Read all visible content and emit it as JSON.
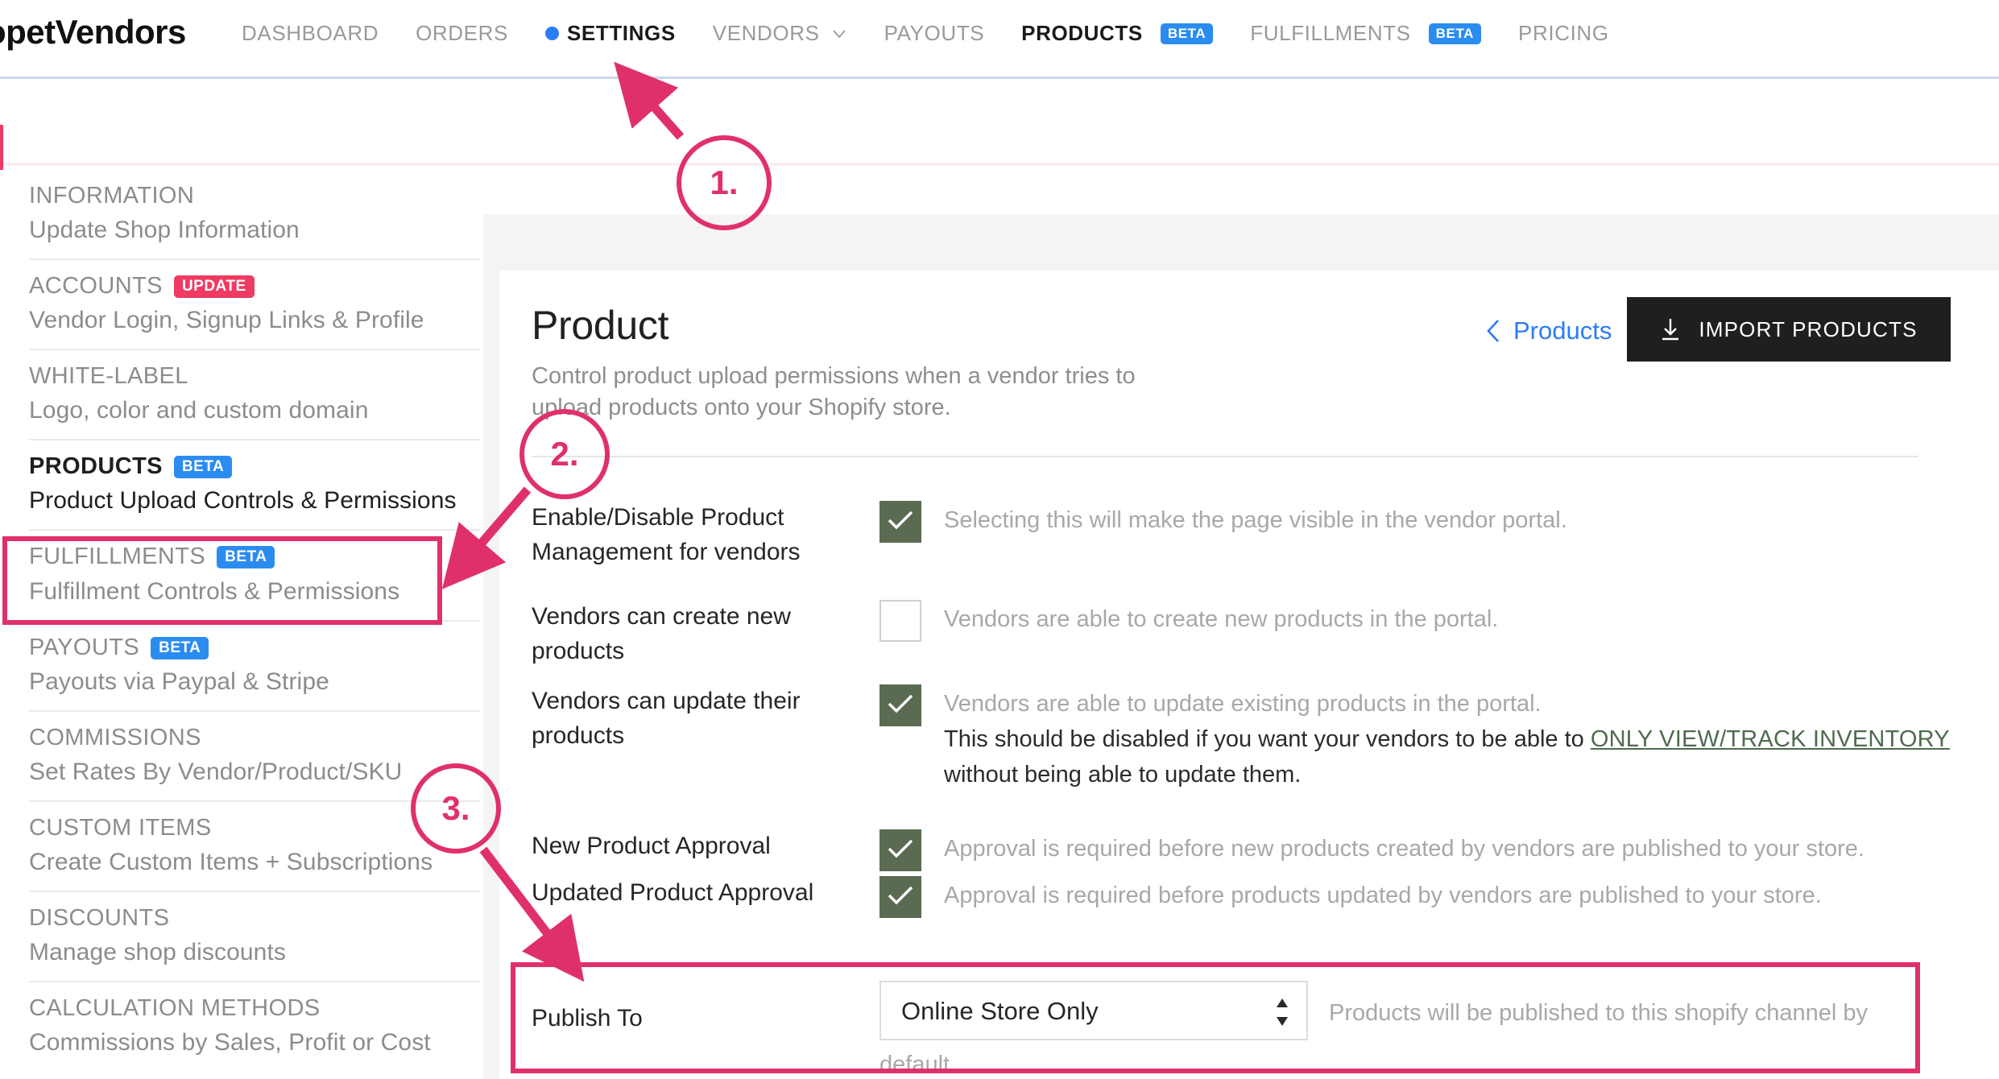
{
  "brand": "opetVendors",
  "nav": {
    "items": [
      {
        "label": "DASHBOARD",
        "active": false,
        "dot": false,
        "badge": null,
        "caret": false
      },
      {
        "label": "ORDERS",
        "active": false,
        "dot": false,
        "badge": null,
        "caret": false
      },
      {
        "label": "SETTINGS",
        "active": true,
        "dot": true,
        "badge": null,
        "caret": false
      },
      {
        "label": "VENDORS",
        "active": false,
        "dot": false,
        "badge": null,
        "caret": true
      },
      {
        "label": "PAYOUTS",
        "active": false,
        "dot": false,
        "badge": null,
        "caret": false
      },
      {
        "label": "PRODUCTS",
        "active": true,
        "dot": false,
        "badge": "BETA",
        "caret": false
      },
      {
        "label": "FULFILLMENTS",
        "active": false,
        "dot": false,
        "badge": "BETA",
        "caret": false
      },
      {
        "label": "PRICING",
        "active": false,
        "dot": false,
        "badge": null,
        "caret": false
      }
    ]
  },
  "sidebar": {
    "items": [
      {
        "title": "INFORMATION",
        "badge": null,
        "badge_type": null,
        "sub": "Update Shop Information",
        "selected": false
      },
      {
        "title": "ACCOUNTS",
        "badge": "UPDATE",
        "badge_type": "update",
        "sub": "Vendor Login, Signup Links & Profile",
        "selected": false
      },
      {
        "title": "WHITE-LABEL",
        "badge": null,
        "badge_type": null,
        "sub": "Logo, color and custom domain",
        "selected": false
      },
      {
        "title": "PRODUCTS",
        "badge": "BETA",
        "badge_type": "beta",
        "sub": "Product Upload Controls & Permissions",
        "selected": true
      },
      {
        "title": "FULFILLMENTS",
        "badge": "BETA",
        "badge_type": "beta",
        "sub": "Fulfillment Controls & Permissions",
        "selected": false
      },
      {
        "title": "PAYOUTS",
        "badge": "BETA",
        "badge_type": "beta",
        "sub": "Payouts via Paypal & Stripe",
        "selected": false
      },
      {
        "title": "COMMISSIONS",
        "badge": null,
        "badge_type": null,
        "sub": "Set Rates By Vendor/Product/SKU",
        "selected": false
      },
      {
        "title": "CUSTOM ITEMS",
        "badge": null,
        "badge_type": null,
        "sub": "Create Custom Items + Subscriptions",
        "selected": false
      },
      {
        "title": "DISCOUNTS",
        "badge": null,
        "badge_type": null,
        "sub": "Manage shop discounts",
        "selected": false
      },
      {
        "title": "CALCULATION METHODS",
        "badge": null,
        "badge_type": null,
        "sub": "Commissions by Sales, Profit or Cost",
        "selected": false
      }
    ]
  },
  "main": {
    "title": "Product",
    "subtitle": "Control product upload permissions when a vendor tries to upload products onto your Shopify store.",
    "back_link": "Products",
    "import_button": "IMPORT PRODUCTS",
    "rows": [
      {
        "label": "Enable/Disable Product Management for vendors",
        "checked": true,
        "desc": "Selecting this will make the page visible in the vendor portal."
      },
      {
        "label": "Vendors can create new products",
        "checked": false,
        "desc": "Vendors are able to create new products in the portal."
      },
      {
        "label": "Vendors can update their products",
        "checked": true,
        "desc": "Vendors are able to update existing products in the portal.",
        "desc_dark_prefix": "This should be disabled if you want your vendors to be able to ",
        "desc_link": "ONLY VIEW/TRACK INVENTORY",
        "desc_dark_suffix": " without being able to update them."
      },
      {
        "label": "New Product Approval",
        "checked": true,
        "desc": "Approval is required before new products created by vendors are published to your store."
      },
      {
        "label": "Updated Product Approval",
        "checked": true,
        "desc": "Approval is required before products updated by vendors are published to your store."
      }
    ],
    "publish": {
      "label": "Publish To",
      "value": "Online Store Only",
      "desc_line1": "Products will be published to this shopify channel by",
      "desc_line2": "default."
    }
  },
  "annotations": {
    "step1": "1.",
    "step2": "2.",
    "step3": "3."
  },
  "colors": {
    "accent_pink": "#e0306c",
    "badge_blue": "#2b8cf0",
    "badge_red": "#ef3b63",
    "link_blue": "#2b7cf6",
    "checkbox_green": "#5a6b52",
    "inventory_link_green": "#4e6b4e"
  }
}
